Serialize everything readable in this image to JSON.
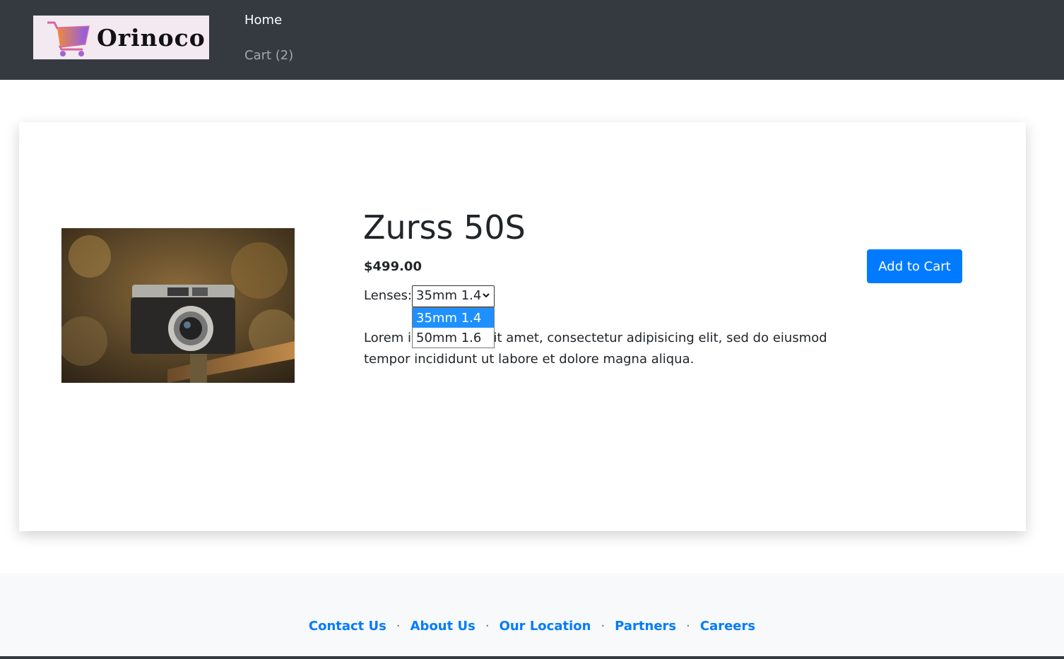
{
  "nav": {
    "logo_text": "Orinoco",
    "home_label": "Home",
    "cart_label": "Cart (2)"
  },
  "product": {
    "title": "Zurss 50S",
    "price": "$499.00",
    "lenses_label": "Lenses:",
    "selected_lens": "35mm 1.4",
    "lens_options": [
      "35mm 1.4",
      "50mm 1.6"
    ],
    "description": "Lorem ipsum dolor sit amet, consectetur adipisicing elit, sed do eiusmod tempor incididunt ut labore et dolore magna aliqua.",
    "add_to_cart_label": "Add to Cart"
  },
  "footer": {
    "links": [
      "Contact Us",
      "About Us",
      "Our Location",
      "Partners",
      "Careers"
    ],
    "separator": "·"
  },
  "colors": {
    "navbar": "#343a40",
    "primary": "#007bff",
    "option_highlight": "#1e90ff"
  },
  "icons": {
    "logo": "shopping-cart-icon",
    "select": "chevron-down-icon"
  }
}
